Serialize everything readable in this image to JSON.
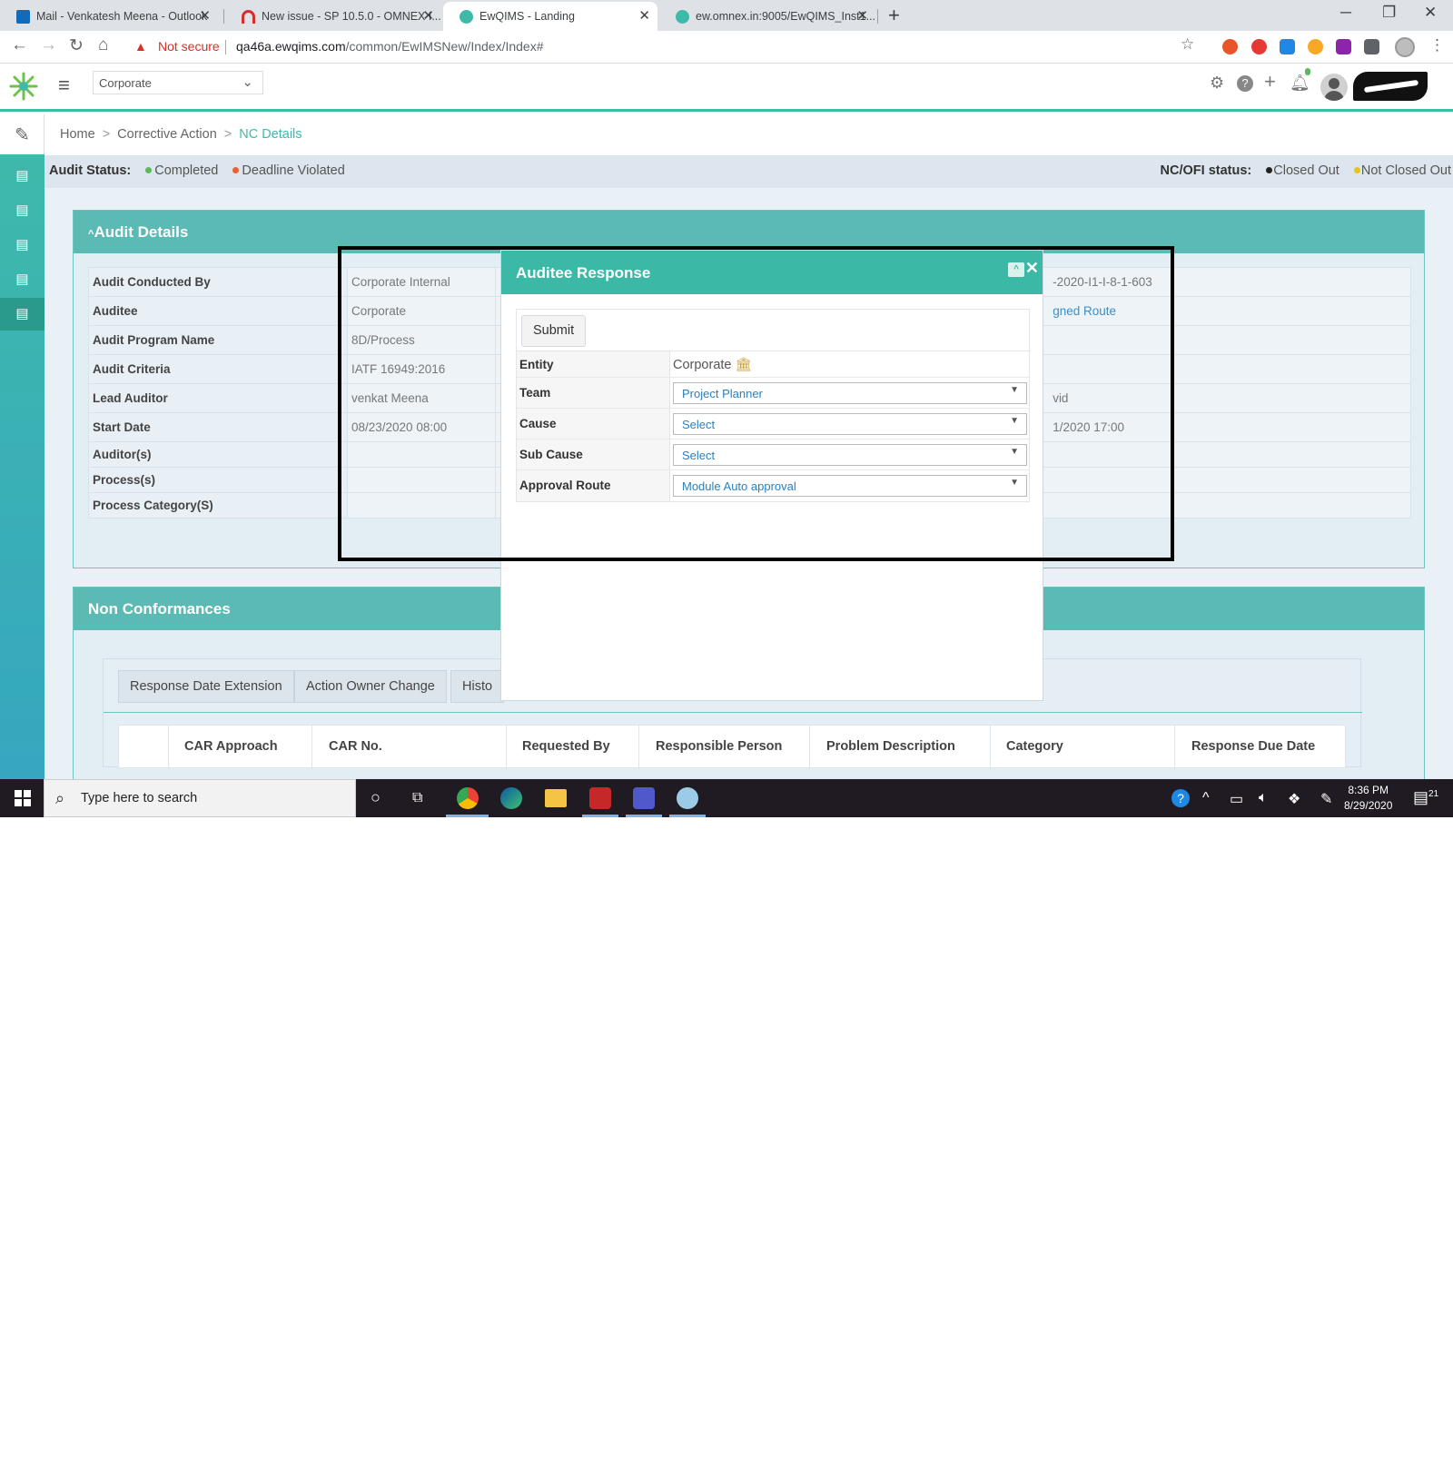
{
  "browser": {
    "tabs": [
      {
        "title": "Mail - Venkatesh Meena - Outlook",
        "icon": "outlook-icon",
        "color": "#0f6cbd"
      },
      {
        "title": "New issue - SP 10.5.0 - OMNEX I...",
        "icon": "issue-tracker-icon",
        "color": "#d32f2f"
      },
      {
        "title": "EwQIMS - Landing",
        "icon": "ewqims-icon",
        "color": "#3fbaa9"
      },
      {
        "title": "ew.omnex.in:9005/EwQIMS_Inst1...",
        "icon": "ewqims-icon",
        "color": "#3fbaa9"
      }
    ],
    "security_warning": "Not secure",
    "url_host": "qa46a.ewqims.com",
    "url_path": "/common/EwIMSNew/Index/Index#"
  },
  "app": {
    "entity_select": "Corporate",
    "accent": "#3fbaa9"
  },
  "breadcrumb": {
    "home": "Home",
    "section": "Corrective Action",
    "current": "NC Details"
  },
  "status": {
    "audit_label": "Audit Status:",
    "completed": "Completed",
    "deadline_violated": "Deadline Violated",
    "ncofi_label": "NC/OFI status:",
    "closed_out": "Closed Out",
    "not_closed_out": "Not Closed Out",
    "colors": {
      "completed": "#5cb85c",
      "deadline": "#e8622d",
      "closed": "#222222",
      "not_closed": "#e8c31a"
    }
  },
  "audit_details": {
    "title": "Audit Details",
    "rows": [
      {
        "label": "Audit Conducted By",
        "value": "Corporate Internal",
        "right": "-2020-I1-I-8-1-603"
      },
      {
        "label": "Auditee",
        "value": "Corporate",
        "right": "gned Route"
      },
      {
        "label": "Audit Program Name",
        "value": "8D/Process",
        "right": ""
      },
      {
        "label": "Audit Criteria",
        "value": "IATF 16949:2016",
        "right": ""
      },
      {
        "label": "Lead Auditor",
        "value": "venkat Meena",
        "right": "vid"
      },
      {
        "label": "Start Date",
        "value": "08/23/2020 08:00",
        "right": "1/2020 17:00"
      },
      {
        "label": "Auditor(s)",
        "value": "",
        "right": ""
      },
      {
        "label": "Process(s)",
        "value": "",
        "right": ""
      },
      {
        "label": "Process Category(S)",
        "value": "",
        "right": ""
      }
    ]
  },
  "non_conformances": {
    "title": "Non Conformances",
    "buttons": [
      "Response Date Extension",
      "Action Owner Change",
      "Histo"
    ],
    "columns": [
      "CAR Approach",
      "CAR No.",
      "Requested By",
      "Responsible Person",
      "Problem Description",
      "Category",
      "Response Due Date"
    ]
  },
  "modal": {
    "title": "Auditee Response",
    "submit": "Submit",
    "fields": {
      "entity_label": "Entity",
      "entity_value": "Corporate",
      "team_label": "Team",
      "team_value": "Project Planner",
      "cause_label": "Cause",
      "cause_value": "Select",
      "subcause_label": "Sub Cause",
      "subcause_value": "Select",
      "route_label": "Approval Route",
      "route_value": "Module Auto approval"
    }
  },
  "taskbar": {
    "search_placeholder": "Type here to search",
    "time": "8:36 PM",
    "date": "8/29/2020",
    "notifications": "21"
  }
}
